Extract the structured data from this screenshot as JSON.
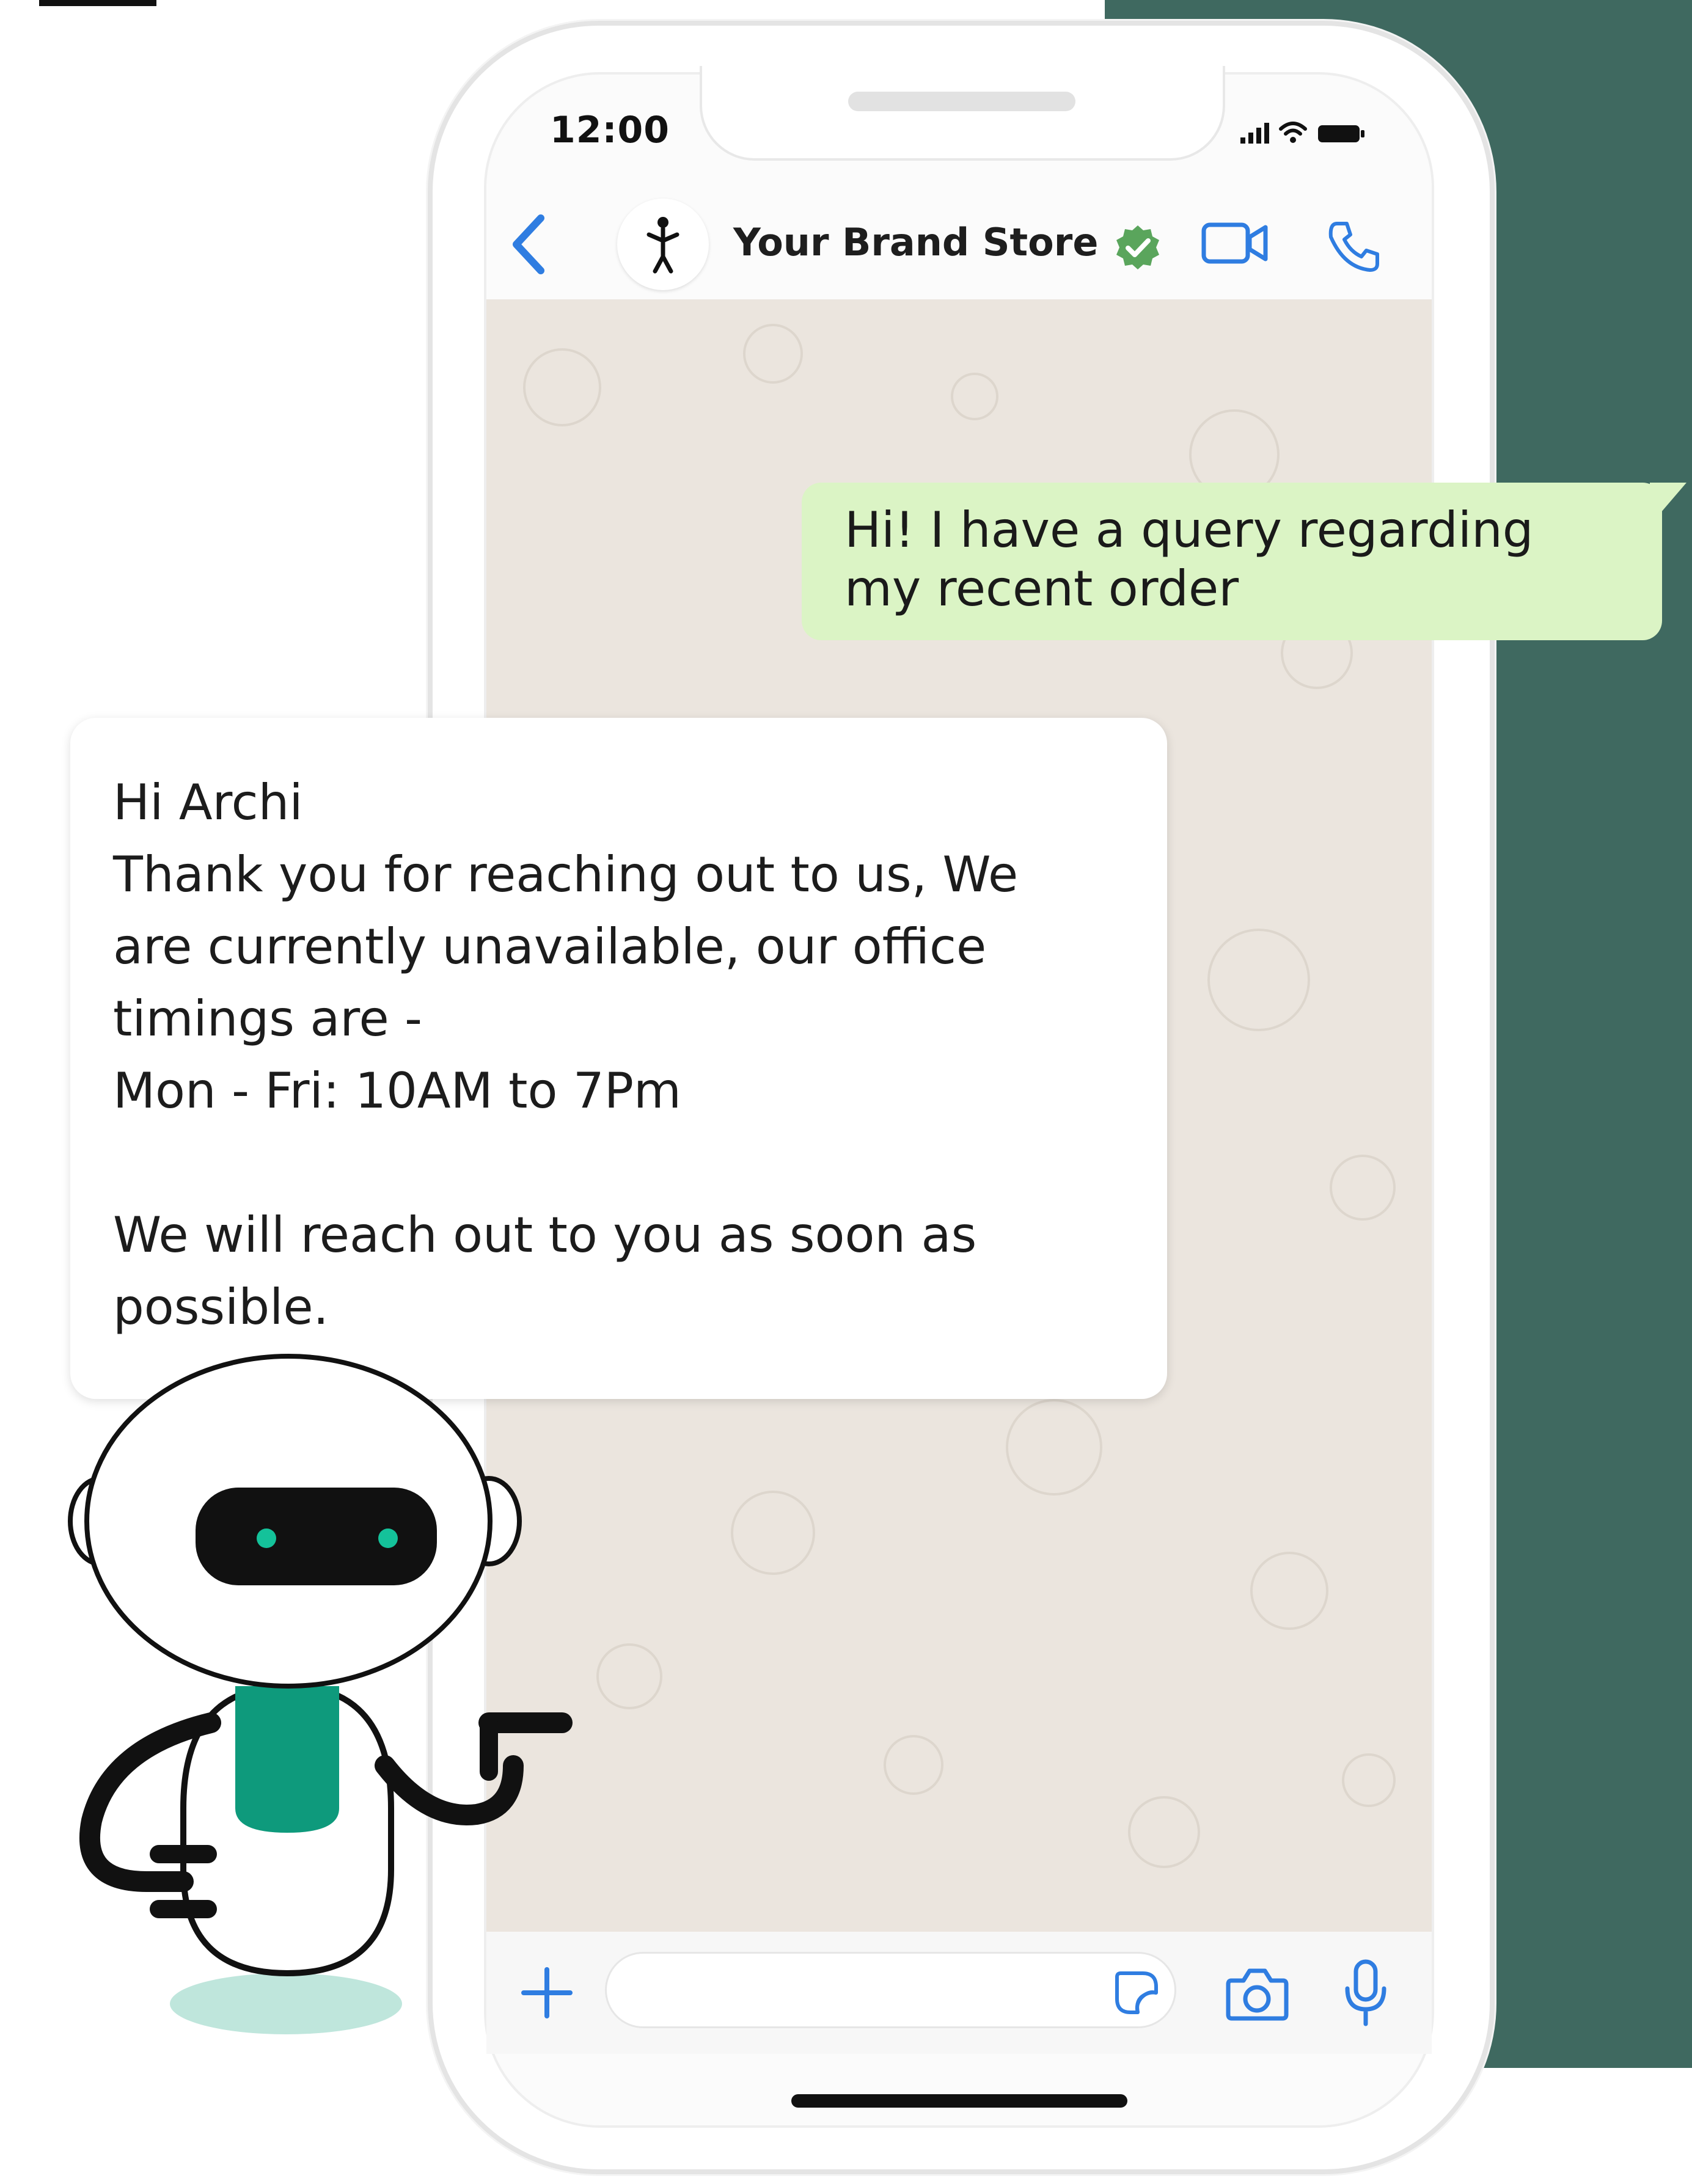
{
  "status_bar": {
    "time": "12:00"
  },
  "header": {
    "brand_name": "Your Brand Store"
  },
  "messages": {
    "outgoing": "Hi! I have a query regarding\nmy recent order",
    "incoming": "Hi Archi\nThank you for reaching out to us, We\nare currently unavailable, our office\ntimings are -\nMon - Fri: 10AM to 7Pm\n\nWe will reach out to you as soon as\npossible."
  },
  "composer": {
    "placeholder": ""
  },
  "colors": {
    "side_panel": "#3f6960",
    "outgoing_bubble": "#dbf4c5",
    "chat_background": "#ebe5de",
    "icon_blue": "#2f7de1",
    "verified_green": "#5aa55c",
    "robot_teal": "#0e9a7c"
  },
  "icons": [
    "back-arrow",
    "brand-logo",
    "verified-badge",
    "video-camera",
    "phone",
    "plus",
    "sticker",
    "camera",
    "microphone",
    "signal",
    "wifi",
    "battery",
    "robot-mascot"
  ]
}
